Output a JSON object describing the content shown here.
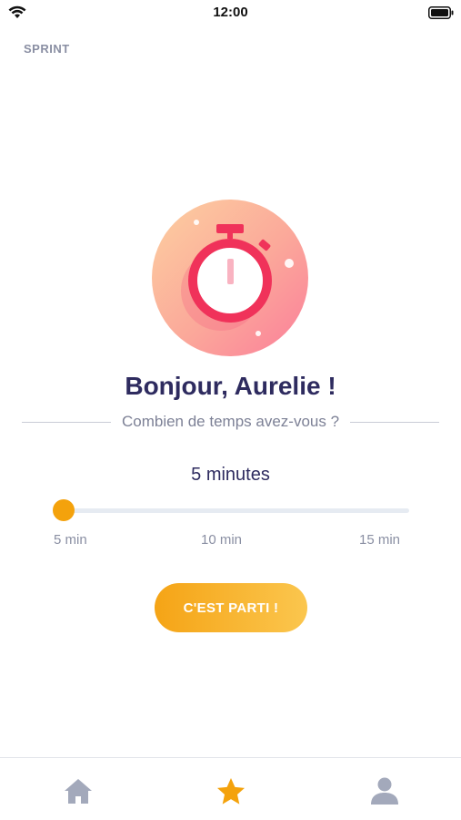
{
  "status_bar": {
    "time": "12:00"
  },
  "header": {
    "section_label": "SPRINT"
  },
  "main": {
    "greeting": "Bonjour, Aurelie !",
    "question": "Combien de temps avez-vous ?",
    "duration_value": "5 minutes",
    "slider": {
      "min_label": "5 min",
      "mid_label": "10 min",
      "max_label": "15 min",
      "value_minutes": 5,
      "min_minutes": 5,
      "max_minutes": 15
    },
    "start_button": "C'EST PARTI !"
  },
  "tab_bar": {
    "items": [
      {
        "icon": "home-icon",
        "active": false
      },
      {
        "icon": "star-icon",
        "active": true
      },
      {
        "icon": "user-icon",
        "active": false
      }
    ]
  },
  "colors": {
    "accent": "#f4a20c",
    "title": "#2e2b5f",
    "muted": "#8a8fa3",
    "tab_inactive": "#a3a9bb",
    "stopwatch": "#f0325a"
  }
}
